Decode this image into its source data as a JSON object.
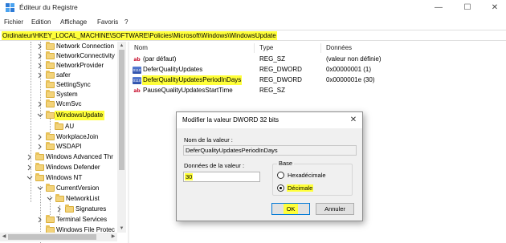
{
  "window": {
    "title": "Éditeur du Registre",
    "controls": {
      "minimize": "—",
      "maximize": "☐",
      "close": "✕"
    },
    "menu": [
      "Fichier",
      "Edition",
      "Affichage",
      "Favoris",
      "?"
    ],
    "address": "Ordinateur\\HKEY_LOCAL_MACHINE\\SOFTWARE\\Policies\\Microsoft\\Windows\\WindowsUpdate"
  },
  "tree": {
    "items": [
      {
        "label": "Network Connection"
      },
      {
        "label": "NetworkConnectivity"
      },
      {
        "label": "NetworkProvider"
      },
      {
        "label": "safer"
      },
      {
        "label": "SettingSync"
      },
      {
        "label": "System"
      },
      {
        "label": "WcmSvc"
      },
      {
        "label": "WindowsUpdate"
      },
      {
        "label": "AU"
      },
      {
        "label": "WorkplaceJoin"
      },
      {
        "label": "WSDAPI"
      },
      {
        "label": "Windows Advanced Thr"
      },
      {
        "label": "Windows Defender"
      },
      {
        "label": "Windows NT"
      },
      {
        "label": "CurrentVersion"
      },
      {
        "label": "NetworkList"
      },
      {
        "label": "Signatures"
      },
      {
        "label": "Terminal Services"
      },
      {
        "label": "Windows File Protec"
      }
    ]
  },
  "list": {
    "headers": {
      "name": "Nom",
      "type": "Type",
      "data": "Données"
    },
    "rows": [
      {
        "name": "(par défaut)",
        "type": "REG_SZ",
        "data": "(valeur non définie)",
        "icon": "string-value-icon",
        "glyph": "ab"
      },
      {
        "name": "DeferQualityUpdates",
        "type": "REG_DWORD",
        "data": "0x00000001 (1)",
        "icon": "dword-value-icon",
        "glyph": "0110"
      },
      {
        "name": "DeferQualityUpdatesPeriodInDays",
        "type": "REG_DWORD",
        "data": "0x0000001e (30)",
        "icon": "dword-value-icon",
        "glyph": "0110"
      },
      {
        "name": "PauseQualityUpdatesStartTime",
        "type": "REG_SZ",
        "data": "",
        "icon": "string-value-icon",
        "glyph": "ab"
      }
    ]
  },
  "dialog": {
    "title": "Modifier la valeur DWORD 32 bits",
    "close": "✕",
    "name_label": "Nom de la valeur :",
    "name_value": "DeferQualityUpdatesPeriodInDays",
    "data_label": "Données de la valeur :",
    "data_value": "30",
    "base_label": "Base",
    "radio_hex": "Hexadécimale",
    "radio_dec": "Décimale",
    "selected_base": "Décimale",
    "ok": "OK",
    "cancel": "Annuler"
  },
  "colors": {
    "highlight": "#ffff3a",
    "folder": "#f3d37a",
    "dialog_bg": "#f0f0f0"
  }
}
